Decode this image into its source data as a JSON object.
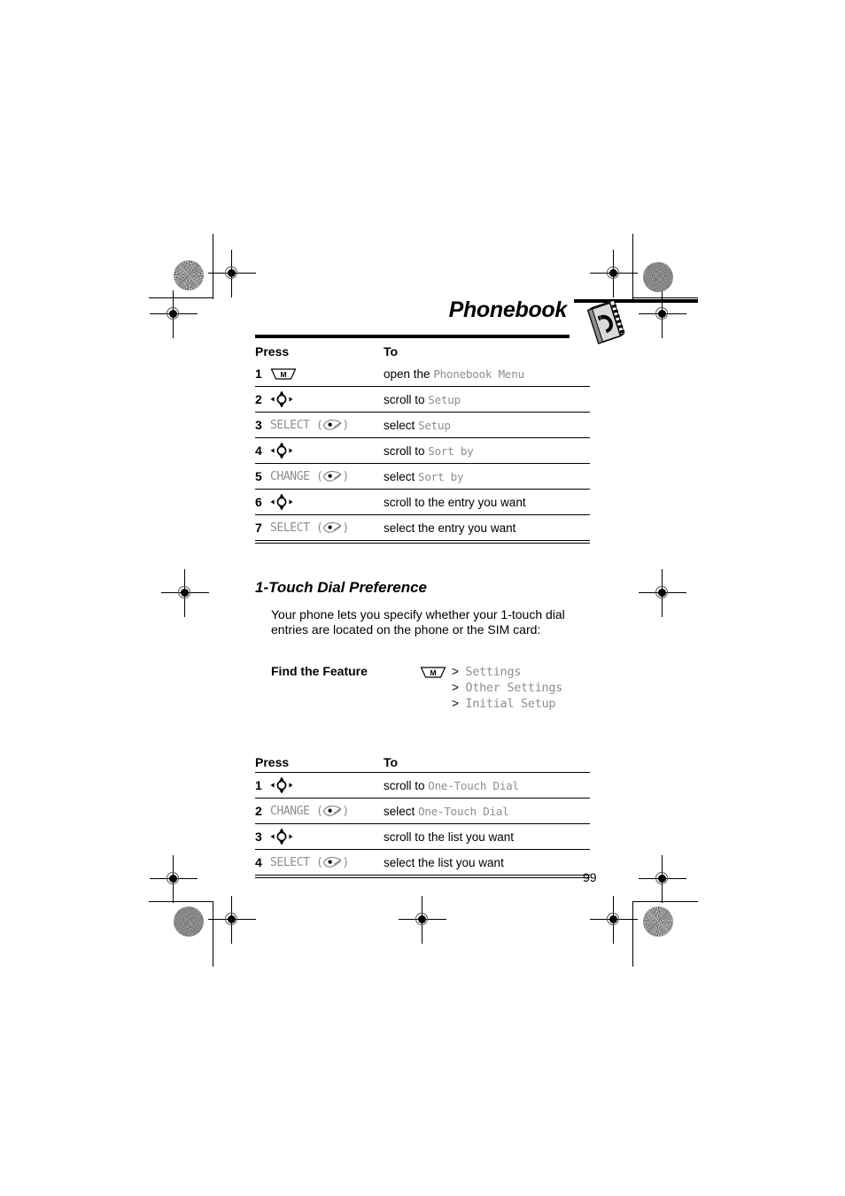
{
  "header": {
    "chapter_title": "Phonebook",
    "icon": "phonebook-book-icon"
  },
  "table1": {
    "columns": [
      "Press",
      "To"
    ],
    "rows": [
      {
        "num": "1",
        "key_icon": "menu-key-icon",
        "key_label": "",
        "action_prefix": "open the ",
        "action_display": "Phonebook Menu",
        "action_suffix": ""
      },
      {
        "num": "2",
        "key_icon": "nav-key-icon",
        "key_label": "",
        "action_prefix": "scroll to ",
        "action_display": "Setup",
        "action_suffix": ""
      },
      {
        "num": "3",
        "key_icon": "softkey-icon",
        "key_label": "SELECT",
        "action_prefix": "select ",
        "action_display": "Setup",
        "action_suffix": ""
      },
      {
        "num": "4",
        "key_icon": "nav-key-icon",
        "key_label": "",
        "action_prefix": "scroll to ",
        "action_display": "Sort by",
        "action_suffix": ""
      },
      {
        "num": "5",
        "key_icon": "softkey-icon",
        "key_label": "CHANGE",
        "action_prefix": "select ",
        "action_display": "Sort by",
        "action_suffix": ""
      },
      {
        "num": "6",
        "key_icon": "nav-key-icon",
        "key_label": "",
        "action_prefix": "scroll to the entry you want",
        "action_display": "",
        "action_suffix": ""
      },
      {
        "num": "7",
        "key_icon": "softkey-icon",
        "key_label": "SELECT",
        "action_prefix": "select the entry you want",
        "action_display": "",
        "action_suffix": ""
      }
    ]
  },
  "section": {
    "heading": "1-Touch Dial Preference",
    "body": "Your phone lets you specify whether your 1-touch dial entries are located on the phone or the SIM card:"
  },
  "find_the_feature": {
    "label": "Find the Feature",
    "key_icon": "menu-key-icon",
    "path": [
      "Settings",
      "Other Settings",
      "Initial Setup"
    ],
    "separator": ">"
  },
  "table2": {
    "columns": [
      "Press",
      "To"
    ],
    "rows": [
      {
        "num": "1",
        "key_icon": "nav-key-icon",
        "key_label": "",
        "action_prefix": "scroll to ",
        "action_display": "One-Touch Dial",
        "action_suffix": ""
      },
      {
        "num": "2",
        "key_icon": "softkey-icon",
        "key_label": "CHANGE",
        "action_prefix": "select ",
        "action_display": "One-Touch Dial",
        "action_suffix": ""
      },
      {
        "num": "3",
        "key_icon": "nav-key-icon",
        "key_label": "",
        "action_prefix": "scroll to the list you want",
        "action_display": "",
        "action_suffix": ""
      },
      {
        "num": "4",
        "key_icon": "softkey-icon",
        "key_label": "SELECT",
        "action_prefix": "select the list you want",
        "action_display": "",
        "action_suffix": ""
      }
    ]
  },
  "footer": {
    "page_number": "99"
  },
  "colors": {
    "display_text": "#8d8d8d",
    "body_text": "#000000",
    "rule": "#000000"
  }
}
